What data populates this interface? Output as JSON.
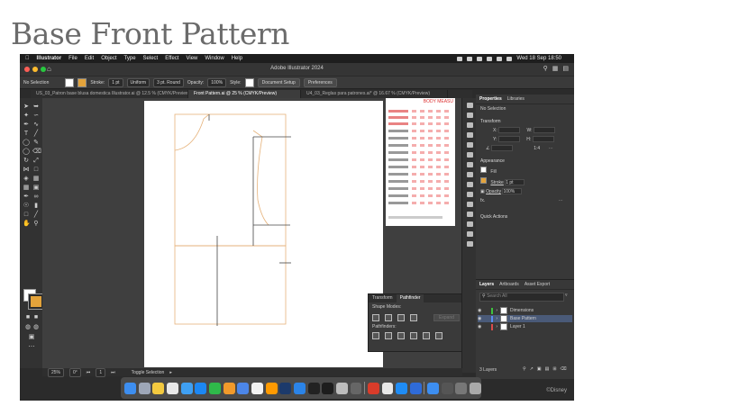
{
  "slide": {
    "title": "Base Front Pattern"
  },
  "menubar": {
    "app": "Illustrator",
    "items": [
      "File",
      "Edit",
      "Object",
      "Type",
      "Select",
      "Effect",
      "View",
      "Window",
      "Help"
    ],
    "clock": "Wed 18 Sep  18:50"
  },
  "window": {
    "title": "Adobe Illustrator 2024"
  },
  "control": {
    "selection": "No Selection",
    "stroke_label": "Stroke:",
    "stroke_value": "1 pt",
    "profile": "Uniform",
    "brush": "3 pt. Round",
    "opacity_label": "Opacity:",
    "opacity_value": "100%",
    "style_label": "Style:",
    "doc_setup": "Document Setup",
    "preferences": "Preferences"
  },
  "tabs": [
    {
      "label": "US_03_Patron base blusa domestica Illustrator.ai @ 12.5 % (CMYK/Preview)"
    },
    {
      "label": "Front Pattern.ai @ 25 % (CMYK/Preview)"
    },
    {
      "label": "U4_03_Reglas para patrones.ai* @ 16.67 % (CMYK/Preview)"
    }
  ],
  "measure_sheet": {
    "heading": "BODY MEASU"
  },
  "floating_panel": {
    "tabs": [
      "Transform",
      "Pathfinder"
    ],
    "shape_modes": "Shape Modes:",
    "expand": "Expand",
    "pathfinders": "Pathfinders:"
  },
  "properties": {
    "tabs": [
      "Properties",
      "Libraries"
    ],
    "no_selection": "No Selection",
    "transform": "Transform",
    "x": "X:",
    "y": "Y:",
    "w": "W:",
    "h": "H:",
    "angle": "1:4",
    "appearance": "Appearance",
    "fill": "Fill",
    "stroke": "Stroke",
    "stroke_value": "1 pt",
    "opacity": "Opacity",
    "opacity_value": "100%",
    "fx": "fx.",
    "quick_actions": "Quick Actions"
  },
  "layers_panel": {
    "tabs": [
      "Layers",
      "Artboards",
      "Asset Export"
    ],
    "search": "Search All",
    "layers": [
      {
        "name": "Dimensions",
        "color": "#3ec23e"
      },
      {
        "name": "Base Pattern",
        "color": "#5a8df2"
      },
      {
        "name": "Layer 1",
        "color": "#d94b4b"
      }
    ],
    "count": "3 Layers"
  },
  "statusbar": {
    "zoom": "25%",
    "rotation": "0°",
    "artboard": "1",
    "action": "Toggle Selection"
  },
  "corner_mark": "©Disney",
  "colors": {
    "accent_orange": "#e3a33b",
    "panel_bg": "#383838",
    "canvas_bg": "#3f3f3f"
  }
}
